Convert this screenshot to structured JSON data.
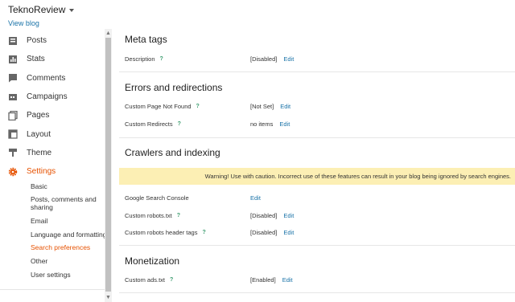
{
  "header": {
    "blog_title": "TeknoReview",
    "view_blog": "View blog"
  },
  "nav": [
    {
      "label": "Posts",
      "icon": "posts-icon"
    },
    {
      "label": "Stats",
      "icon": "stats-icon"
    },
    {
      "label": "Comments",
      "icon": "comments-icon"
    },
    {
      "label": "Campaigns",
      "icon": "campaigns-icon"
    },
    {
      "label": "Pages",
      "icon": "pages-icon"
    },
    {
      "label": "Layout",
      "icon": "layout-icon"
    },
    {
      "label": "Theme",
      "icon": "theme-icon"
    },
    {
      "label": "Settings",
      "icon": "gear-icon"
    }
  ],
  "settings_sub": [
    "Basic",
    "Posts, comments and sharing",
    "Email",
    "Language and formatting",
    "Search preferences",
    "Other",
    "User settings"
  ],
  "colors": {
    "accent": "#e65100",
    "link": "#1a73a8",
    "warning_bg": "#fcefb4",
    "help": "#3b9c6e"
  },
  "sections": {
    "meta": {
      "title": "Meta tags",
      "description": {
        "label": "Description",
        "help": "?",
        "value": "[Disabled]",
        "edit": "Edit"
      }
    },
    "errors": {
      "title": "Errors and redirections",
      "not_found": {
        "label": "Custom Page Not Found",
        "help": "?",
        "value": "[Not Set]",
        "edit": "Edit"
      },
      "redirects": {
        "label": "Custom Redirects",
        "help": "?",
        "value": "no items",
        "edit": "Edit"
      }
    },
    "crawlers": {
      "title": "Crawlers and indexing",
      "warning": "Warning! Use with caution. Incorrect use of these features can result in your blog being ignored by search engines.",
      "console": {
        "label": "Google Search Console",
        "edit": "Edit"
      },
      "robots": {
        "label": "Custom robots.txt",
        "help": "?",
        "value": "[Disabled]",
        "edit": "Edit"
      },
      "robots_header": {
        "label": "Custom robots header tags",
        "help": "?",
        "value": "[Disabled]",
        "edit": "Edit"
      }
    },
    "monetization": {
      "title": "Monetization",
      "ads": {
        "label": "Custom ads.txt",
        "help": "?",
        "value": "[Enabled]",
        "edit": "Edit"
      }
    }
  }
}
